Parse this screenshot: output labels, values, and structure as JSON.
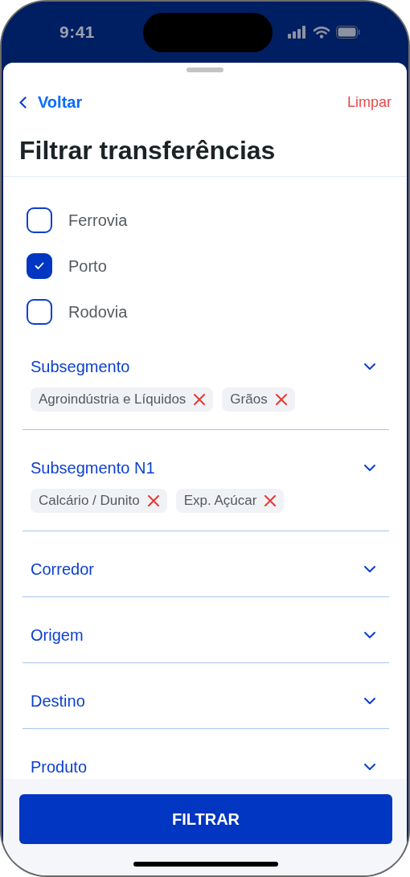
{
  "status_bar": {
    "time": "9:41"
  },
  "header": {
    "back": "Voltar",
    "clear": "Limpar"
  },
  "title": "Filtrar transferências",
  "modes": [
    {
      "label": "Ferrovia",
      "checked": false
    },
    {
      "label": "Porto",
      "checked": true
    },
    {
      "label": "Rodovia",
      "checked": false
    }
  ],
  "filters": [
    {
      "label": "Subsegmento",
      "chips": [
        "Agroindústria e Líquidos",
        "Grãos"
      ]
    },
    {
      "label": "Subsegmento N1",
      "chips": [
        "Calcário / Dunito",
        "Exp. Açúcar"
      ]
    },
    {
      "label": "Corredor"
    },
    {
      "label": "Origem"
    },
    {
      "label": "Destino"
    },
    {
      "label": "Produto"
    }
  ],
  "submit": "FILTRAR"
}
